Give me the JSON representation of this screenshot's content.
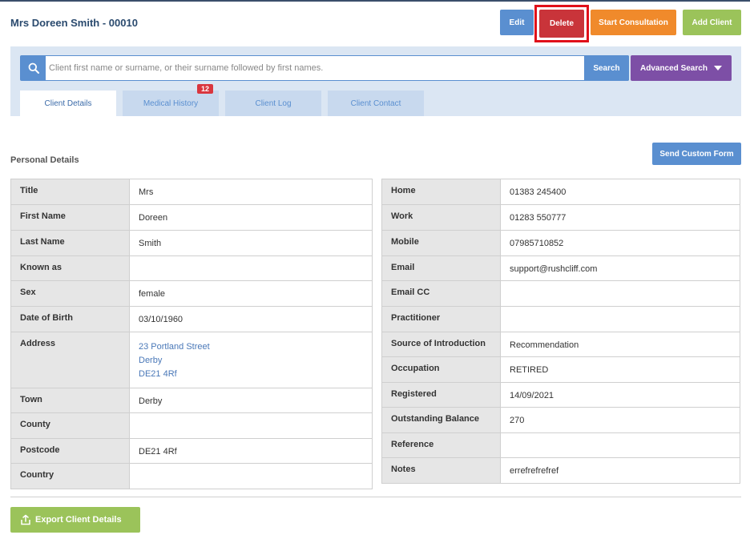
{
  "header": {
    "client_title": "Mrs Doreen Smith - 00010",
    "edit_label": "Edit",
    "delete_label": "Delete",
    "consult_label": "Start Consultation",
    "add_client_label": "Add Client"
  },
  "search": {
    "placeholder": "Client first name or surname, or their surname followed by first names.",
    "search_label": "Search",
    "advanced_label": "Advanced Search"
  },
  "tabs": [
    {
      "label": "Client Details",
      "active": true
    },
    {
      "label": "Medical History",
      "badge": "12"
    },
    {
      "label": "Client Log"
    },
    {
      "label": "Client Contact"
    }
  ],
  "section": {
    "title": "Personal Details",
    "custom_form_label": "Send Custom Form"
  },
  "personal": [
    {
      "label": "Title",
      "value": "Mrs"
    },
    {
      "label": "First Name",
      "value": "Doreen"
    },
    {
      "label": "Last Name",
      "value": "Smith"
    },
    {
      "label": "Known as",
      "value": ""
    },
    {
      "label": "Sex",
      "value": "female"
    },
    {
      "label": "Date of Birth",
      "value": "03/10/1960"
    },
    {
      "label": "Address",
      "lines": [
        "23 Portland Street",
        "Derby",
        "DE21 4Rf"
      ]
    },
    {
      "label": "Town",
      "value": "Derby"
    },
    {
      "label": "County",
      "value": ""
    },
    {
      "label": "Postcode",
      "value": "DE21 4Rf"
    },
    {
      "label": "Country",
      "value": ""
    }
  ],
  "contact": [
    {
      "label": "Home",
      "value": "01383 245400"
    },
    {
      "label": "Work",
      "value": "01283 550777"
    },
    {
      "label": "Mobile",
      "value": "07985710852"
    },
    {
      "label": "Email",
      "value": "support@rushcliff.com"
    },
    {
      "label": "Email CC",
      "value": ""
    },
    {
      "label": "Practitioner",
      "value": ""
    },
    {
      "label": "Source of Introduction",
      "value": "Recommendation"
    },
    {
      "label": "Occupation",
      "value": "RETIRED"
    },
    {
      "label": "Registered",
      "value": "14/09/2021"
    },
    {
      "label": "Outstanding Balance",
      "value": "270"
    },
    {
      "label": "Reference",
      "value": ""
    },
    {
      "label": "Notes",
      "value": "errefrefrefref"
    }
  ],
  "footer": {
    "export_label": "Export Client Details"
  },
  "colors": {
    "primary": "#5a8fd0",
    "danger": "#c9343a",
    "highlight": "#e0101a",
    "orange": "#f08a2b",
    "green": "#9bc35a",
    "purple": "#7d4fa6"
  },
  "icons": {
    "search": "search-icon",
    "caret": "chevron-down-icon",
    "export": "export-icon"
  }
}
